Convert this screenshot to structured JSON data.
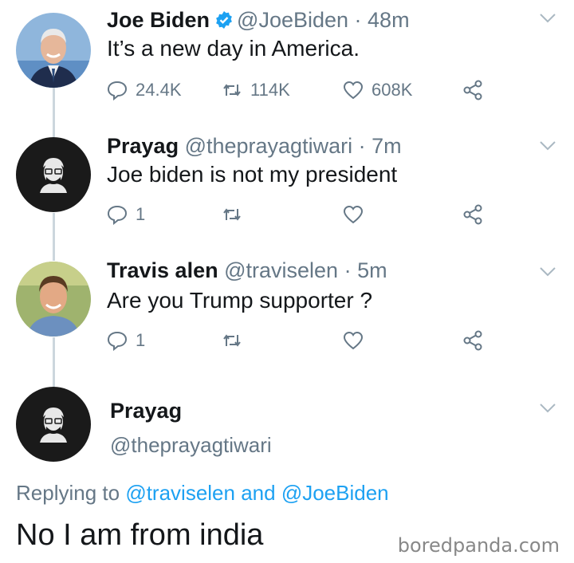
{
  "tweets": [
    {
      "name": "Joe Biden",
      "verified": true,
      "handle": "@JoeBiden",
      "time": "· 48m",
      "text": "It’s a new day in America.",
      "replies": "24.4K",
      "retweets": "114K",
      "likes": "608K"
    },
    {
      "name": "Prayag",
      "handle": "@theprayagtiwari",
      "time": "· 7m",
      "text": "Joe biden is not my president",
      "replies": "1",
      "retweets": "",
      "likes": ""
    },
    {
      "name": "Travis alen",
      "handle": "@traviselen",
      "time": "· 5m",
      "text": "Are you Trump supporter ?",
      "replies": "1",
      "retweets": "",
      "likes": ""
    }
  ],
  "final_tweet": {
    "name": "Prayag",
    "handle": "@theprayagtiwari",
    "replying_prefix": "Replying to ",
    "mention_1": "@traviselen",
    "and": " and ",
    "mention_2": "@JoeBiden",
    "text": "No I am from india"
  },
  "watermark": "boredpanda.com",
  "colors": {
    "verified": "#1da1f2",
    "muted": "#657786",
    "mention": "#1da1f2",
    "thread_line": "#ccd6dd"
  },
  "icons": [
    "reply-icon",
    "retweet-icon",
    "like-icon",
    "share-icon",
    "chevron-down-icon",
    "verified-badge-icon"
  ]
}
